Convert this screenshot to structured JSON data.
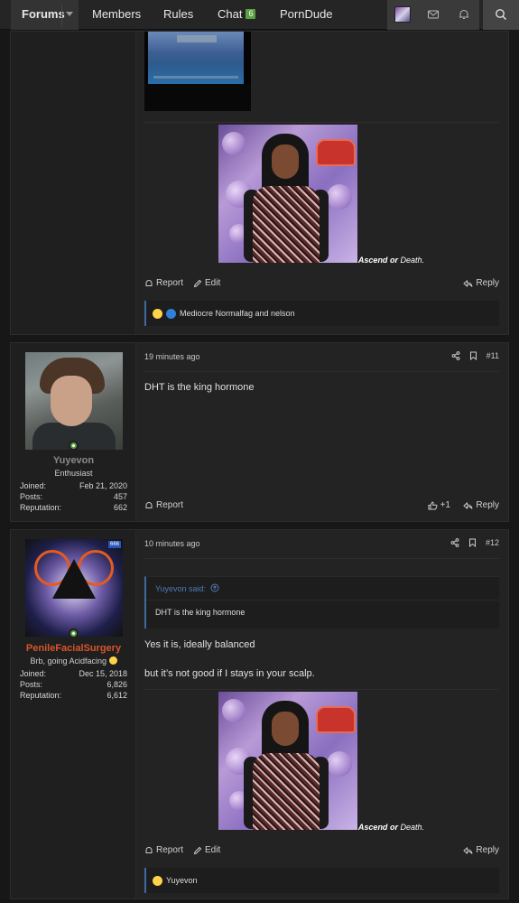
{
  "nav": {
    "forums": "Forums",
    "members": "Members",
    "rules": "Rules",
    "chat": "Chat",
    "chat_badge": "6",
    "porndude": "PornDude"
  },
  "post10": {
    "signature_bold": "Ascend",
    "signature_or": "or",
    "signature_end": "Death.",
    "actions": {
      "report": "Report",
      "edit": "Edit",
      "reply": "Reply"
    },
    "reactions_text": "Mediocre Normalfag and nelson"
  },
  "post11": {
    "user": {
      "name": "Yuyevon",
      "title": "Enthusiast",
      "name_color": "#8a8a8a",
      "joined_label": "Joined:",
      "joined": "Feb 21, 2020",
      "posts_label": "Posts:",
      "posts": "457",
      "rep_label": "Reputation:",
      "rep": "662"
    },
    "time": "19 minutes ago",
    "number": "#11",
    "body": "DHT is the king hormone",
    "actions": {
      "report": "Report",
      "like_count": "+1",
      "reply": "Reply"
    }
  },
  "post12": {
    "user": {
      "name": "PenileFacialSurgery",
      "title": "Brb, going Acidfacing",
      "name_color": "#d9542b",
      "joined_label": "Joined:",
      "joined": "Dec 15, 2018",
      "posts_label": "Posts:",
      "posts": "6,826",
      "rep_label": "Reputation:",
      "rep": "6,612",
      "avatar_badge": "666"
    },
    "time": "10 minutes ago",
    "number": "#12",
    "quote_author": "Yuyevon said:",
    "quote_text": "DHT is the king hormone",
    "body_line1": "Yes it is, ideally balanced",
    "body_line2": "but it’s not good if I stays in your scalp.",
    "signature_bold": "Ascend",
    "signature_or": "or",
    "signature_end": "Death.",
    "actions": {
      "report": "Report",
      "edit": "Edit",
      "reply": "Reply"
    },
    "reactions_text": "Yuyevon"
  },
  "colors": {
    "accent_blue": "#3e6aa0",
    "online_green": "#5aa142"
  }
}
